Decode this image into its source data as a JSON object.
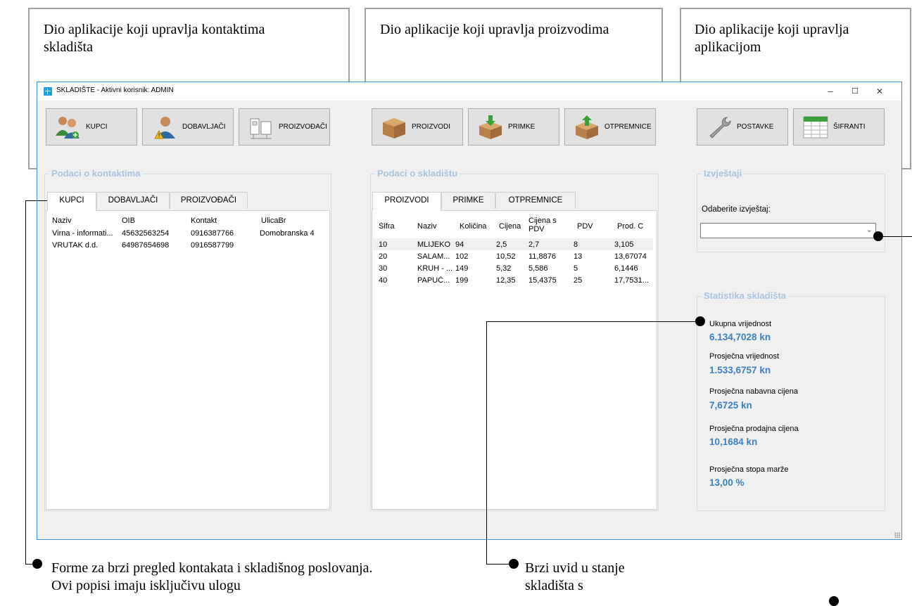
{
  "annotations": {
    "top_left": "Dio aplikacije koji upravlja kontaktima skladišta",
    "top_middle": "Dio aplikacije koji upravlja proizvodima",
    "top_right": "Dio aplikacije koji upravlja aplikacijom",
    "bottom_left": "Forme za brzi pregled kontakata i skladišnog poslovanja. Ovi popisi imaju isključivu ulogu",
    "bottom_middle": "Brzi uvid u stanje skladišta s"
  },
  "window": {
    "title": "SKLADIŠTE -  Aktivni korisnik: ADMIN",
    "controls": {
      "minimize": "–",
      "maximize": "☐",
      "close": "✕"
    }
  },
  "toolbar": {
    "kupci": "KUPCI",
    "dobavljaci": "DOBAVLJAČI",
    "proizvodaci": "PROIZVOĐAČI",
    "proizvodi": "PROIZVODI",
    "primke": "PRIMKE",
    "otpremnice": "OTPREMNICE",
    "postavke": "POSTAVKE",
    "sifranti": "ŠIFRANTI"
  },
  "contacts": {
    "group_title": "Podaci o kontaktima",
    "tabs": [
      "KUPCI",
      "DOBAVLJAČI",
      "PROIZVOĐAČI"
    ],
    "columns": [
      "Naziv",
      "OIB",
      "Kontakt",
      "UlicaBr"
    ],
    "rows": [
      [
        "Virna - informati...",
        "45632563254",
        "0916387766",
        "Domobranska 4"
      ],
      [
        "VRUTAK d.d.",
        "64987654698",
        "0916587799",
        ""
      ]
    ]
  },
  "warehouse": {
    "group_title": "Podaci o skladištu",
    "tabs": [
      "PROIZVODI",
      "PRIMKE",
      "OTPREMNICE"
    ],
    "columns": [
      "Šifra",
      "Naziv",
      "Količina",
      "Cijena",
      "Cijena s PDV",
      "PDV",
      "Prod. C"
    ],
    "rows": [
      [
        "10",
        "MLIJEKO",
        "94",
        "2,5",
        "2,7",
        "8",
        "3,105"
      ],
      [
        "20",
        "SALAM...",
        "102",
        "10,52",
        "11,8876",
        "13",
        "13,67074"
      ],
      [
        "30",
        "KRUH - ...",
        "149",
        "5,32",
        "5,586",
        "5",
        "6,1446"
      ],
      [
        "40",
        "PAPUČ...",
        "199",
        "12,35",
        "15,4375",
        "25",
        "17,7531..."
      ]
    ]
  },
  "reports": {
    "group_title": "Izvještaji",
    "label": "Odaberite izvještaj:",
    "selected": ""
  },
  "stats": {
    "group_title": "Statistika skladišta",
    "items": [
      {
        "label": "Ukupna vrijednost",
        "value": "6.134,7028 kn"
      },
      {
        "label": "Prosječna vrijednost",
        "value": "1.533,6757 kn"
      },
      {
        "label": "Prosječna nabavna cijena",
        "value": "7,6725 kn"
      },
      {
        "label": "Prosječna prodajna cijena",
        "value": "10,1684 kn"
      },
      {
        "label": "Prosječna stopa marže",
        "value": "13,00 %"
      }
    ]
  }
}
